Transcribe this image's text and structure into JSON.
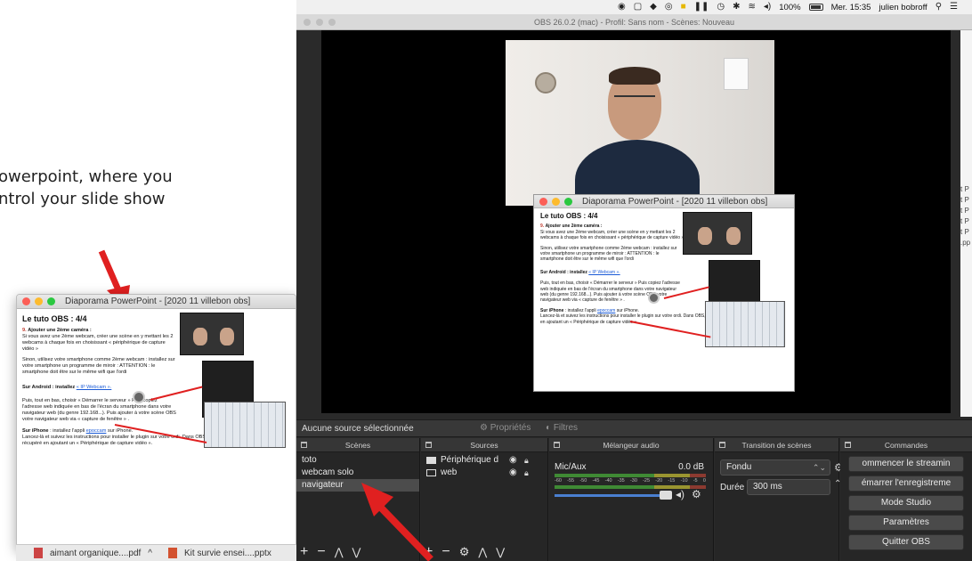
{
  "caption": {
    "line1": "owerpoint, where you",
    "line2": "ntrol your slide show"
  },
  "slide": {
    "window_title": "Diaporama PowerPoint - [2020 11 villebon obs]",
    "title": "Le tuto OBS : 4/4",
    "section_num": "9.",
    "section_heading": "Ajouter une 2ème caméra :",
    "p1": "Si vous avez une 2ème webcam, créer une scène en y mettant les 2 webcams à chaque fois en choisissant « périphérique de capture vidéo »",
    "p2": "Sinon, utilisez votre smartphone comme 2ème webcam : installez sur votre smartphone un programme de miroir : ATTENTION : le smartphone doit être sur le même wifi que l'ordi",
    "android_label": "Sur Android : installez",
    "android_link": "« IP Webcam ».",
    "p3": "Puis, tout en bas, choisir « Démarrer le serveur » Puis copiez l'adresse web indiquée en bas de l'écran du smartphone dans votre navigateur web (du genre 192.168...). Puis ajouter à votre scène OBS votre navigateur web via « capture de fenêtre » .",
    "iphone_label": "Sur iPhone",
    "iphone_text1": ": installez l'appli",
    "iphone_link": "epoccam",
    "iphone_text2": "sur iPhone.",
    "p4": "Lancez-là et suivez les instructions pour installer le plugin sur votre ordi. Dans OBS, mettre ensuite le flux vidéo récupéré en ajoutant un « Périphérique de capture vidéo »."
  },
  "menubar": {
    "battery_pct": "100%",
    "datetime": "Mer. 15:35",
    "user": "julien bobroff"
  },
  "obs": {
    "window_title": "OBS 26.0.2 (mac) - Profil: Sans nom - Scènes: Nouveau",
    "no_source": "Aucune source sélectionnée",
    "properties": "Propriétés",
    "filters": "Filtres",
    "scenes_header": "Scènes",
    "sources_header": "Sources",
    "mixer_header": "Mélangeur audio",
    "transitions_header": "Transition de scènes",
    "commands_header": "Commandes",
    "scenes": [
      "toto",
      "webcam solo",
      "navigateur"
    ],
    "selected_scene": 2,
    "sources": [
      {
        "label": "Périphérique d",
        "icon": "camera-icon"
      },
      {
        "label": "web",
        "icon": "window-icon"
      }
    ],
    "mixer": {
      "name": "Mic/Aux",
      "db": "0.0 dB",
      "scale": [
        "-60",
        "-55",
        "-50",
        "-45",
        "-40",
        "-35",
        "-30",
        "-25",
        "-20",
        "-15",
        "-10",
        "-5",
        "0"
      ]
    },
    "transition": {
      "select": "Fondu",
      "duration_label": "Durée",
      "duration_value": "300 ms"
    },
    "commands": [
      "ommencer le streamin",
      "émarrer l'enregistreme",
      "Mode Studio",
      "Paramètres",
      "Quitter OBS"
    ]
  },
  "right_strip": [
    "t P",
    "t P",
    "t P",
    "t P",
    "t P",
    ".pp"
  ],
  "taskbar": {
    "file1": "aimant organique....pdf",
    "file2": "Kit survie ensei....pptx"
  },
  "colors": {
    "accent_red": "#e02020",
    "obs_bg": "#2a2a2a",
    "volume_blue": "#4a7fd0"
  }
}
